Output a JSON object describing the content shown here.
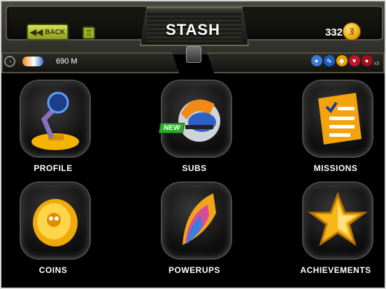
{
  "header": {
    "title": "STASH",
    "back_label": "BACK",
    "coins": "332",
    "coin_symbol": "●",
    "trophy_icon": "♖"
  },
  "status": {
    "distance": "690 M",
    "gauge_icon": "◔",
    "powerups": [
      {
        "name": "bubbles-icon",
        "color": "#3a7bd5",
        "glyph": "●"
      },
      {
        "name": "wave-icon",
        "color": "#1f5fc4",
        "glyph": "∿"
      },
      {
        "name": "shield-icon",
        "color": "#e6a400",
        "glyph": "◆"
      },
      {
        "name": "heart-icon",
        "color": "#c4142b",
        "glyph": "♥"
      },
      {
        "name": "bomb-icon",
        "color": "#a01020",
        "glyph": "●"
      }
    ],
    "powerup_label": "x3"
  },
  "tiles": [
    {
      "label": "PROFILE"
    },
    {
      "label": "SUBS",
      "badge": "NEW"
    },
    {
      "label": "MISSIONS"
    },
    {
      "label": "COINS"
    },
    {
      "label": "POWERUPS"
    },
    {
      "label": "ACHIEVEMENTS"
    }
  ]
}
